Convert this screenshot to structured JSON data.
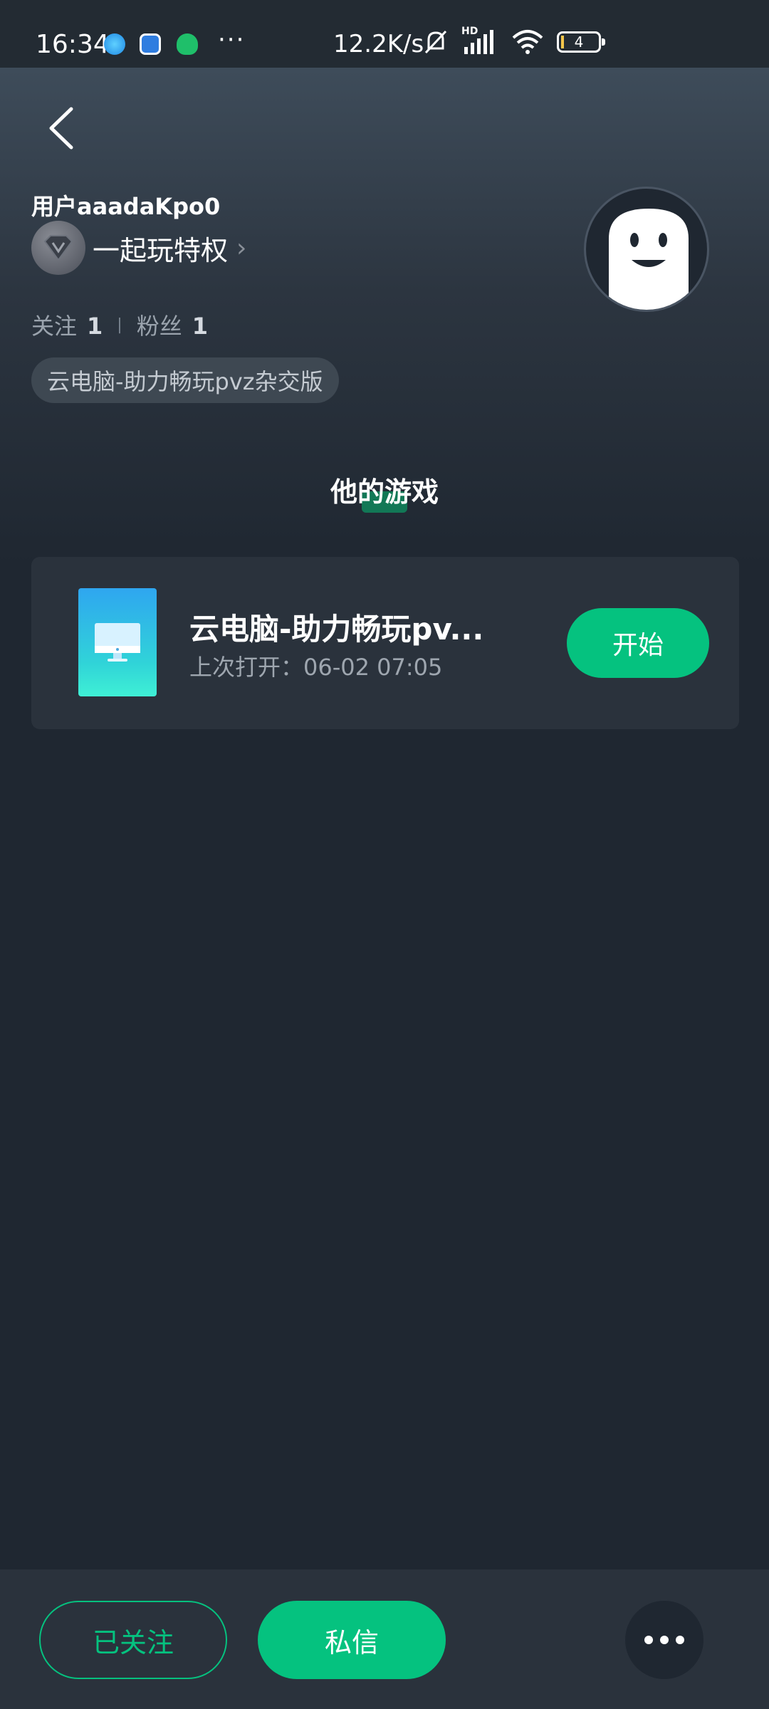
{
  "status_bar": {
    "time": "16:34",
    "overflow_dots": "···",
    "net_speed": "12.2K/s",
    "signal_label": "HD",
    "battery_level": "4"
  },
  "profile": {
    "username": "用户aaadaKpo0",
    "vip_label": "一起玩特权",
    "follow_label": "关注",
    "follow_count": "1",
    "fans_label": "粉丝",
    "fans_count": "1",
    "game_chip": "云电脑-助力畅玩pvz杂交版"
  },
  "section": {
    "title": "他的游戏"
  },
  "games": [
    {
      "name": "云电脑-助力畅玩pv...",
      "last_opened": "上次打开：06-02 07:05",
      "action_label": "开始"
    }
  ],
  "bottom_bar": {
    "followed_label": "已关注",
    "message_label": "私信"
  },
  "colors": {
    "accent": "#05c27f",
    "background": "#1f2731",
    "card": "#2a323c"
  }
}
